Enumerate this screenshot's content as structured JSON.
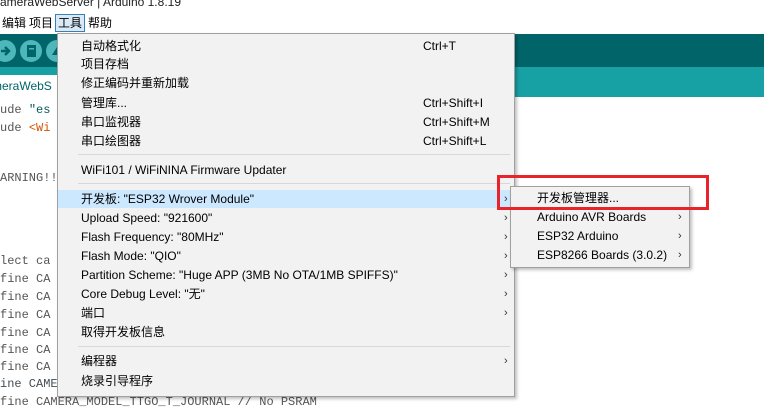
{
  "title_bar": {
    "text": "ameraWebServer | Arduino 1.8.19"
  },
  "menubar": [
    {
      "label": "编辑"
    },
    {
      "label": "项目"
    },
    {
      "label": "工具"
    },
    {
      "label": "帮助"
    }
  ],
  "tab": {
    "label": "meraWebS"
  },
  "code_lines": [
    {
      "pre": "ude ",
      "str": "\"es"
    },
    {
      "pre": "ude ",
      "str": "<Wi"
    },
    {
      "pre": "ARNING!!",
      "str": ""
    },
    {
      "pre": "lect ca",
      "str": ""
    },
    {
      "pre": "fine CA",
      "str": ""
    },
    {
      "pre": "fine CA",
      "str": ""
    },
    {
      "pre": "fine CA",
      "str": ""
    },
    {
      "pre": "fine CA",
      "str": ""
    },
    {
      "pre": "fine CA",
      "str": ""
    },
    {
      "pre": "fine CA",
      "str": ""
    },
    {
      "pre": "ine CAME",
      "str": ""
    },
    {
      "pre": "fine CAMERA_MODEL_TTGO_T_JOURNAL // No PSRAM",
      "str": ""
    }
  ],
  "tools_menu": {
    "items": [
      {
        "label": "自动格式化",
        "shortcut": "Ctrl+T"
      },
      {
        "label": "项目存档",
        "shortcut": ""
      },
      {
        "label": "修正编码并重新加载",
        "shortcut": ""
      },
      {
        "label": "管理库...",
        "shortcut": "Ctrl+Shift+I"
      },
      {
        "label": "串口监视器",
        "shortcut": "Ctrl+Shift+M"
      },
      {
        "label": "串口绘图器",
        "shortcut": "Ctrl+Shift+L"
      },
      {
        "label": "WiFi101 / WiFiNINA Firmware Updater",
        "shortcut": ""
      },
      {
        "label": "开发板: \"ESP32 Wrover Module\"",
        "arrow": "›"
      },
      {
        "label": "Upload Speed: \"921600\"",
        "arrow": "›"
      },
      {
        "label": "Flash Frequency: \"80MHz\"",
        "arrow": "›"
      },
      {
        "label": "Flash Mode: \"QIO\"",
        "arrow": "›"
      },
      {
        "label": "Partition Scheme: \"Huge APP (3MB No OTA/1MB SPIFFS)\"",
        "arrow": "›"
      },
      {
        "label": "Core Debug Level: \"无\"",
        "arrow": "›"
      },
      {
        "label": "端口",
        "arrow": "›"
      },
      {
        "label": "取得开发板信息",
        "arrow": ""
      },
      {
        "label": "编程器",
        "arrow": "›"
      },
      {
        "label": "烧录引导程序",
        "arrow": ""
      }
    ]
  },
  "board_submenu": {
    "items": [
      {
        "label": "开发板管理器...",
        "arrow": ""
      },
      {
        "label": "Arduino AVR Boards",
        "arrow": "›"
      },
      {
        "label": "ESP32 Arduino",
        "arrow": "›"
      },
      {
        "label": "ESP8266 Boards (3.0.2)",
        "arrow": "›"
      }
    ]
  },
  "colors": {
    "toolbar": "#006468",
    "tabbar": "#17a1a5",
    "menu_bg": "#f2f2f2",
    "highlight": "#cce8ff",
    "annotation": "#e8232a"
  }
}
